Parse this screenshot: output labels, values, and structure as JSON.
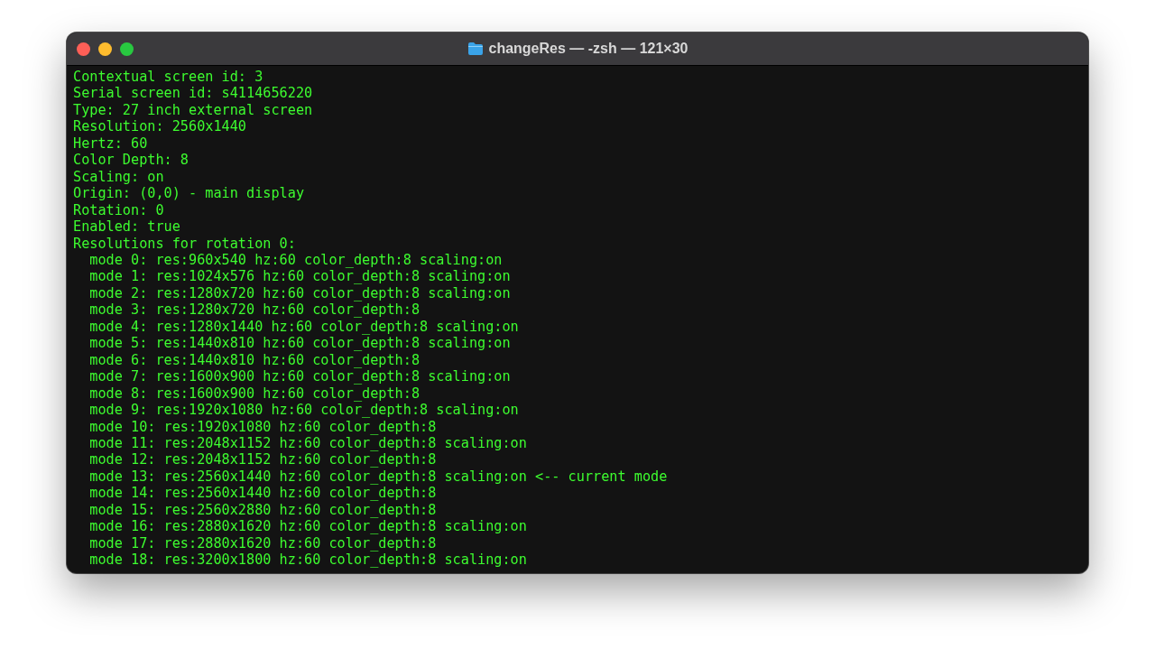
{
  "window": {
    "title": "changeRes — -zsh — 121×30"
  },
  "terminal_lines": [
    "Contextual screen id: 3",
    "Serial screen id: s4114656220",
    "Type: 27 inch external screen",
    "Resolution: 2560x1440",
    "Hertz: 60",
    "Color Depth: 8",
    "Scaling: on",
    "Origin: (0,0) - main display",
    "Rotation: 0",
    "Enabled: true",
    "Resolutions for rotation 0:",
    "  mode 0: res:960x540 hz:60 color_depth:8 scaling:on",
    "  mode 1: res:1024x576 hz:60 color_depth:8 scaling:on",
    "  mode 2: res:1280x720 hz:60 color_depth:8 scaling:on",
    "  mode 3: res:1280x720 hz:60 color_depth:8",
    "  mode 4: res:1280x1440 hz:60 color_depth:8 scaling:on",
    "  mode 5: res:1440x810 hz:60 color_depth:8 scaling:on",
    "  mode 6: res:1440x810 hz:60 color_depth:8",
    "  mode 7: res:1600x900 hz:60 color_depth:8 scaling:on",
    "  mode 8: res:1600x900 hz:60 color_depth:8",
    "  mode 9: res:1920x1080 hz:60 color_depth:8 scaling:on",
    "  mode 10: res:1920x1080 hz:60 color_depth:8",
    "  mode 11: res:2048x1152 hz:60 color_depth:8 scaling:on",
    "  mode 12: res:2048x1152 hz:60 color_depth:8",
    "  mode 13: res:2560x1440 hz:60 color_depth:8 scaling:on <-- current mode",
    "  mode 14: res:2560x1440 hz:60 color_depth:8",
    "  mode 15: res:2560x2880 hz:60 color_depth:8",
    "  mode 16: res:2880x1620 hz:60 color_depth:8 scaling:on",
    "  mode 17: res:2880x1620 hz:60 color_depth:8",
    "  mode 18: res:3200x1800 hz:60 color_depth:8 scaling:on"
  ]
}
